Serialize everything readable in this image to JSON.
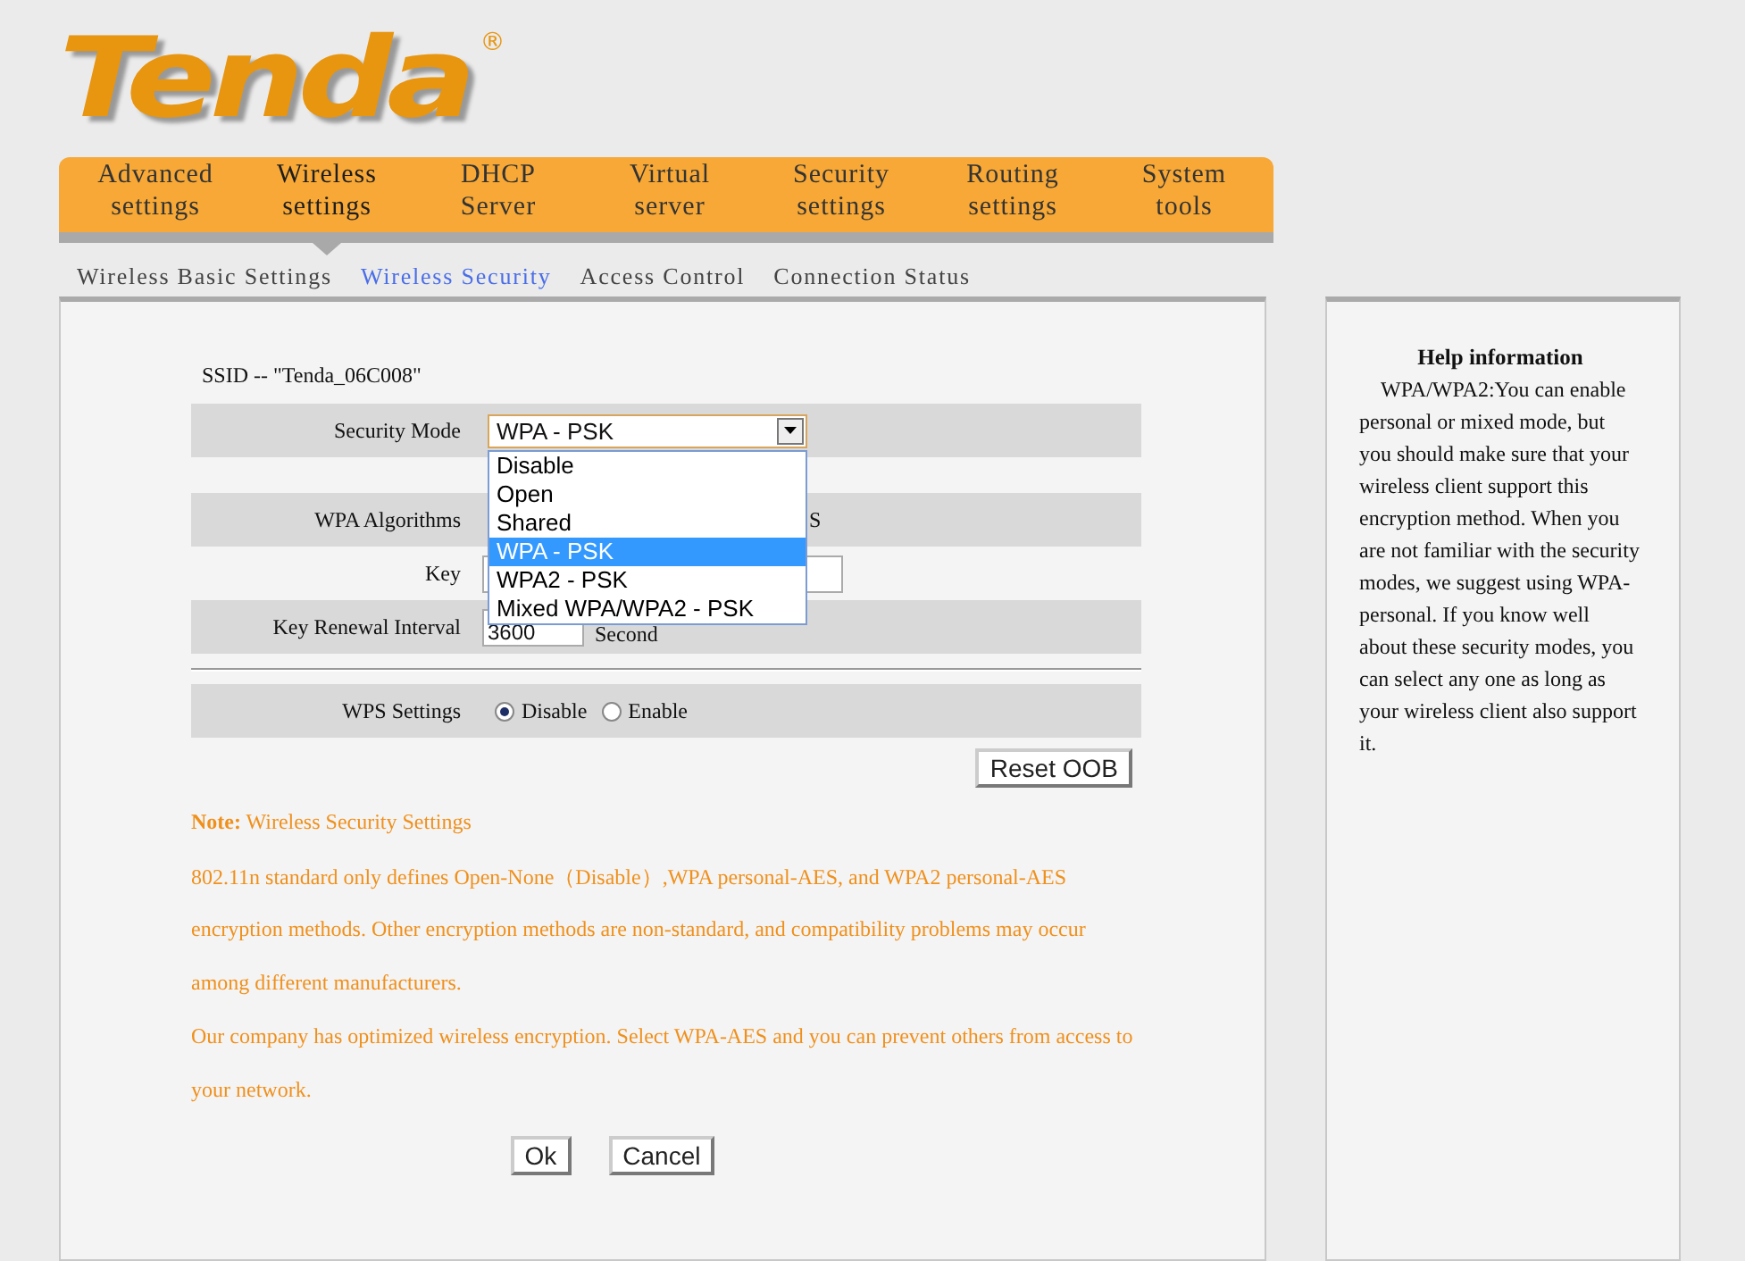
{
  "logo": {
    "text": "Tenda",
    "mark": "®"
  },
  "nav": [
    {
      "label": "Advanced settings",
      "selected": false
    },
    {
      "label": "Wireless settings",
      "selected": true
    },
    {
      "label": "DHCP Server",
      "selected": false
    },
    {
      "label": "Virtual server",
      "selected": false
    },
    {
      "label": "Security settings",
      "selected": false
    },
    {
      "label": "Routing settings",
      "selected": false
    },
    {
      "label": "System tools",
      "selected": false
    }
  ],
  "subnav": [
    {
      "label": "Wireless Basic Settings",
      "selected": false
    },
    {
      "label": "Wireless Security",
      "selected": true
    },
    {
      "label": "Access Control",
      "selected": false
    },
    {
      "label": "Connection Status",
      "selected": false
    }
  ],
  "form": {
    "ssid": "SSID -- \"Tenda_06C008\"",
    "rows": [
      {
        "kind": "select",
        "label": "Security Mode",
        "shaded": true,
        "value": "WPA - PSK",
        "expanded": true,
        "options": [
          {
            "label": "Disable",
            "selected": false
          },
          {
            "label": "Open",
            "selected": false
          },
          {
            "label": "Shared",
            "selected": false
          },
          {
            "label": "WPA - PSK",
            "selected": true
          },
          {
            "label": "WPA2 - PSK",
            "selected": false
          },
          {
            "label": "Mixed WPA/WPA2 - PSK",
            "selected": false
          }
        ]
      },
      {
        "kind": "covered",
        "label": "WPA Algorithms",
        "shaded": true,
        "fragment": "S"
      },
      {
        "kind": "input",
        "label": "Key",
        "shaded": false
      },
      {
        "kind": "interval",
        "label": "Key Renewal Interval",
        "shaded": true,
        "value": "3600",
        "unit": "Second"
      }
    ],
    "wps": {
      "label": "WPS Settings",
      "options": [
        {
          "label": "Disable",
          "selected": true
        },
        {
          "label": "Enable",
          "selected": false
        }
      ]
    },
    "reset_button": "Reset OOB"
  },
  "note": {
    "heading": "**Note:** Wireless Security Settings",
    "lines": [
      "802.11n standard only defines Open-None（Disable）,WPA personal-AES, and WPA2 personal-AES",
      "encryption methods. Other encryption methods are non-standard, and compatibility problems may occur",
      "among different manufacturers.",
      "Our company has optimized wireless encryption. Select WPA-AES and you can prevent others from access to",
      "your network."
    ]
  },
  "buttons": [
    "Ok",
    "Cancel"
  ],
  "help": {
    "title": "Help information",
    "text": "WPA/WPA2:You can enable personal or mixed mode, but you should make sure that your wireless client support this encryption method. When you are not familiar with the security modes, we suggest using WPA-personal. If you know well about these security modes, you can select any one as long as your wireless client also support it."
  }
}
